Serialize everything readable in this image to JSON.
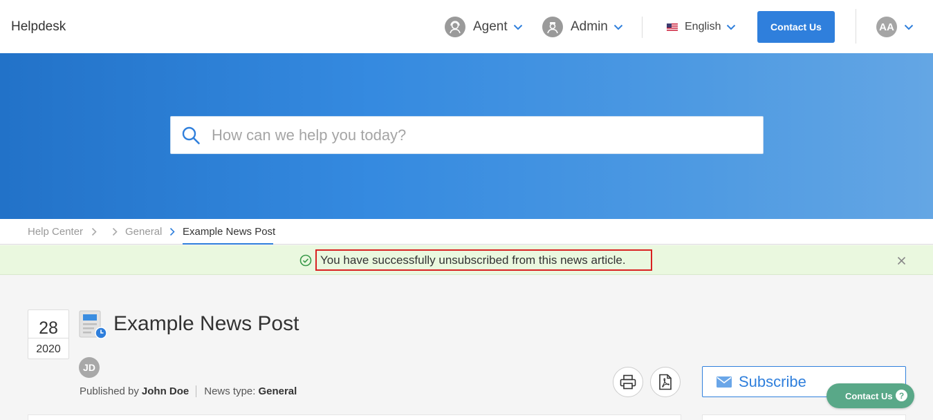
{
  "header": {
    "brand": "Helpdesk",
    "agent_label": "Agent",
    "admin_label": "Admin",
    "language_label": "English",
    "contact_button": "Contact Us",
    "user_initials": "AA"
  },
  "search": {
    "placeholder": "How can we help you today?"
  },
  "breadcrumb": {
    "items": [
      "Help Center",
      "General",
      "Example News Post"
    ]
  },
  "alert": {
    "message": "You have successfully unsubscribed from this news article."
  },
  "article": {
    "day": "28",
    "year": "2020",
    "title": "Example News Post",
    "author_initials": "JD",
    "published_by_label": "Published by",
    "author_name": "John Doe",
    "news_type_label": "News type:",
    "news_type": "General"
  },
  "sidebar": {
    "subscribe_label": "Subscribe"
  },
  "floating_contact": {
    "label": "Contact Us",
    "help_glyph": "?"
  },
  "icons": {
    "agent": "headset-user-icon",
    "admin": "admin-user-icon",
    "flag": "us-flag-icon",
    "search": "search-icon",
    "check": "check-circle-icon",
    "close": "close-icon",
    "news": "news-article-icon",
    "print": "printer-icon",
    "pdf": "pdf-icon",
    "subscribe": "envelope-icon"
  },
  "colors": {
    "accent": "#2f7fdc",
    "alert_bg": "#eaf8df",
    "alert_highlight": "#d92121",
    "float_contact_bg": "#59a888"
  }
}
